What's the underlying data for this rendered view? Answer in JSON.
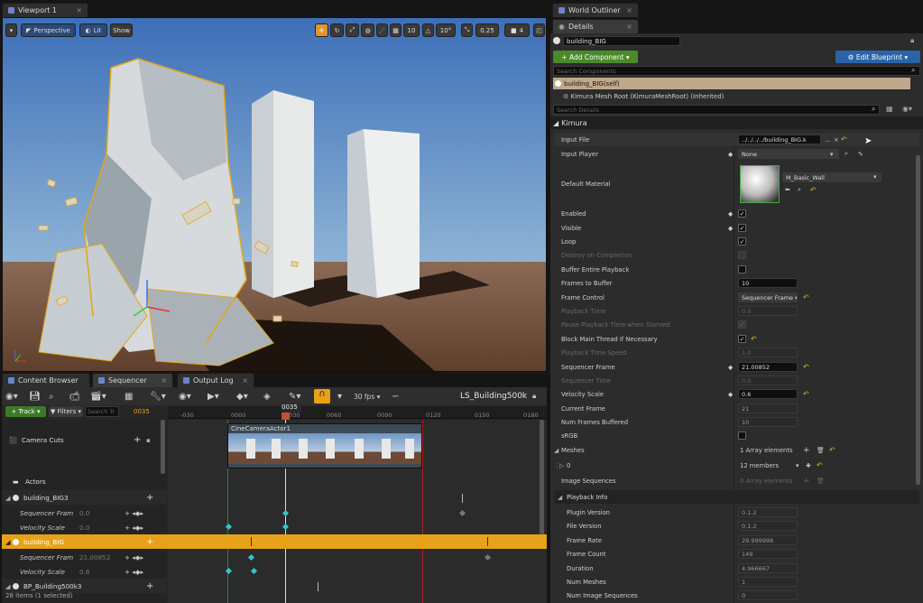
{
  "viewport": {
    "tab_label": "Viewport 1",
    "perspective_label": "Perspective",
    "lit_label": "Lit",
    "show_label": "Show",
    "grid_snap": "10",
    "rot_snap": "10°",
    "scale_snap": "0.25",
    "camera_speed": "4"
  },
  "outliner": {
    "tab_label": "World Outliner"
  },
  "details": {
    "tab_label": "Details",
    "object_name": "building_BIG",
    "add_component_label": "+ Add Component ▾",
    "edit_blueprint_label": "⚙ Edit Blueprint ▾",
    "search_components_placeholder": "Search Components",
    "component_self": "building_BIG(self)",
    "component_root": "Kimura Mesh Root (KimuraMeshRoot) (Inherited)",
    "search_details_placeholder": "Search Details",
    "section_kimura": "Kimura",
    "props": {
      "input_file_label": "Input File",
      "input_file_value": "../../../../building_BIG.k",
      "input_player_label": "Input Player",
      "input_player_value": "None",
      "default_material_label": "Default Material",
      "default_material_value": "M_Basic_Wall",
      "enabled_label": "Enabled",
      "visible_label": "Visible",
      "loop_label": "Loop",
      "destroy_label": "Destroy on Completion",
      "buffer_entire_label": "Buffer Entire Playback",
      "frames_to_buffer_label": "Frames to Buffer",
      "frames_to_buffer_value": "10",
      "frame_control_label": "Frame Control",
      "frame_control_value": "Sequencer Frame ▾",
      "playback_time_label": "Playback Time",
      "playback_time_value": "0.0",
      "pause_playback_label": "Pause Playback Time when Starved",
      "block_main_label": "Block Main Thread if Necessary",
      "playback_speed_label": "Playback Time Speed",
      "playback_speed_value": "1.0",
      "sequencer_frame_label": "Sequencer Frame",
      "sequencer_frame_value": "21.00852",
      "sequencer_time_label": "Sequencer Time",
      "sequencer_time_value": "0.0",
      "velocity_scale_label": "Velocity Scale",
      "velocity_scale_value": "0.6",
      "current_frame_label": "Current Frame",
      "current_frame_value": "21",
      "num_frames_buffered_label": "Num Frames Buffered",
      "num_frames_buffered_value": "10",
      "srgb_label": "sRGB",
      "meshes_label": "Meshes",
      "meshes_value": "1 Array elements",
      "mesh0_label": "0",
      "mesh0_value": "12 members",
      "image_sequences_label": "Image Sequences",
      "image_sequences_value": "0 Array elements"
    },
    "playback_info": {
      "header": "Playback Info",
      "plugin_version_label": "Plugin Version",
      "plugin_version_value": "0.1.2",
      "file_version_label": "File Version",
      "file_version_value": "0.1.2",
      "frame_rate_label": "Frame Rate",
      "frame_rate_value": "29.999998",
      "frame_count_label": "Frame Count",
      "frame_count_value": "149",
      "duration_label": "Duration",
      "duration_value": "4.966667",
      "num_meshes_label": "Num Meshes",
      "num_meshes_value": "1",
      "num_image_seq_label": "Num Image Sequences",
      "num_image_seq_value": "0"
    }
  },
  "bottom_tabs": {
    "content_browser": "Content Browser",
    "sequencer": "Sequencer",
    "output_log": "Output Log"
  },
  "sequencer": {
    "fps_label": "30 fps ▾",
    "sequence_name": "LS_Building500k",
    "track_button": "+ Track ▾",
    "filters_button": "Filters ▾",
    "search_placeholder": "Search Tr",
    "current_frame": "0035",
    "playhead_label": "0035",
    "ruler": [
      "-030",
      "0000",
      "0030",
      "0060",
      "0090",
      "0120",
      "0150",
      "0180"
    ],
    "camera_cuts": "Camera Cuts",
    "camera_clip": "CineCameraActor1",
    "actors_folder": "Actors",
    "tracks": [
      {
        "name": "building_BIG3",
        "children": [
          {
            "name": "Sequencer Fram",
            "value": "0.0"
          },
          {
            "name": "Velocity Scale",
            "value": "0.0"
          }
        ]
      },
      {
        "name": "building_BIG",
        "children": [
          {
            "name": "Sequencer Fram",
            "value": "21.00852"
          },
          {
            "name": "Velocity Scale",
            "value": "0.6"
          }
        ]
      },
      {
        "name": "BP_Building500k3",
        "children": []
      }
    ],
    "status": "28 items (1 selected)"
  },
  "colors": {
    "accent_orange": "#e8a217",
    "green_button": "#4a8a2a",
    "blue_button": "#2a64a8",
    "keyframe": "#2ec6d0"
  }
}
